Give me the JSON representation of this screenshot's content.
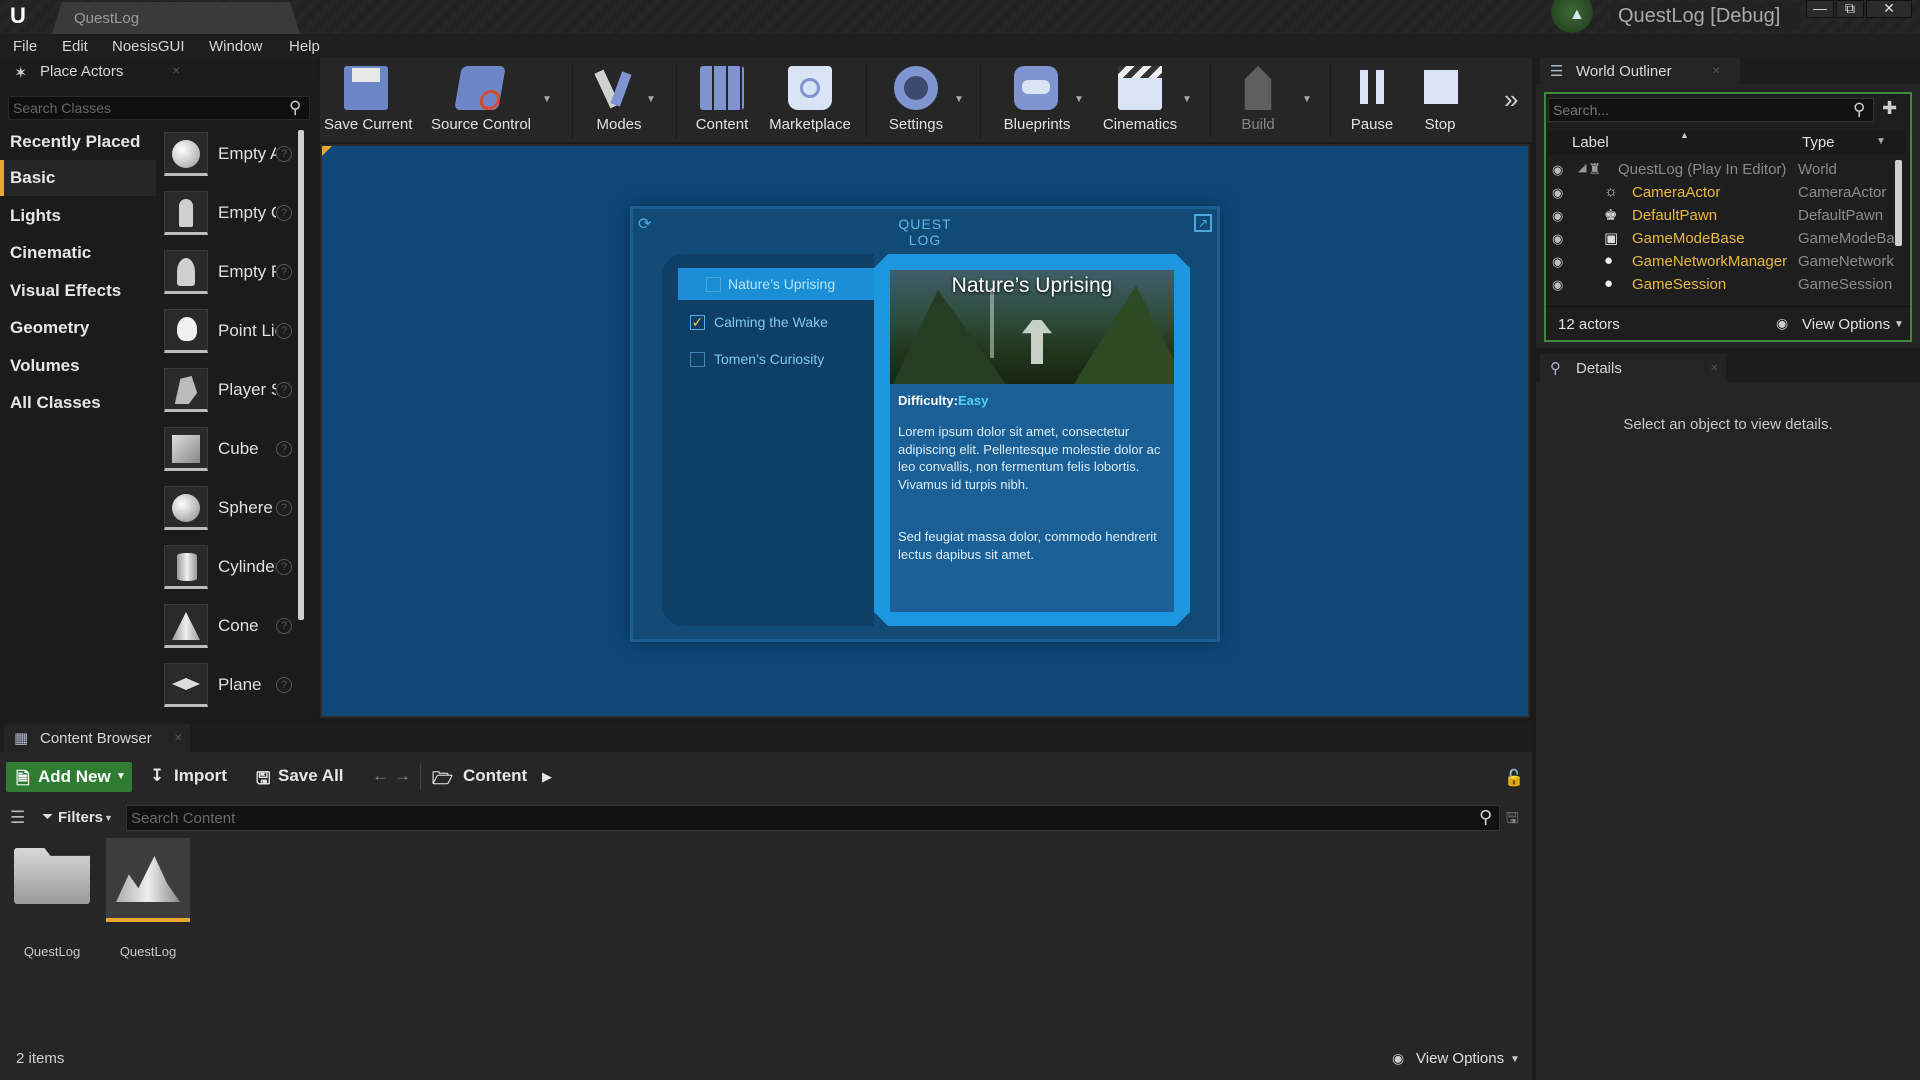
{
  "titlebar": {
    "doc_tab": "QuestLog",
    "window_title": "QuestLog [Debug]",
    "buttons": [
      "—",
      "⧉",
      "✕"
    ]
  },
  "menu": [
    "File",
    "Edit",
    "NoesisGUI",
    "Window",
    "Help"
  ],
  "place_actors": {
    "title": "Place Actors",
    "search_placeholder": "Search Classes",
    "categories": [
      "Recently Placed",
      "Basic",
      "Lights",
      "Cinematic",
      "Visual Effects",
      "Geometry",
      "Volumes",
      "All Classes"
    ],
    "active_category": "Basic",
    "actors": [
      "Empty Actor",
      "Empty Character",
      "Empty Pawn",
      "Point Light",
      "Player Start",
      "Cube",
      "Sphere",
      "Cylinder",
      "Cone",
      "Plane"
    ]
  },
  "toolbar": {
    "save_current": "Save Current",
    "source_control": "Source Control",
    "modes": "Modes",
    "content": "Content",
    "marketplace": "Marketplace",
    "settings": "Settings",
    "blueprints": "Blueprints",
    "cinematics": "Cinematics",
    "build": "Build",
    "pause": "Pause",
    "stop": "Stop"
  },
  "quest_log": {
    "title": "QUEST LOG",
    "quests": [
      {
        "name": "Nature’s Uprising",
        "checked": false,
        "selected": true
      },
      {
        "name": "Calming the Wake",
        "checked": true,
        "selected": false
      },
      {
        "name": "Tomen’s Curiosity",
        "checked": false,
        "selected": false
      }
    ],
    "detail": {
      "name": "Nature’s Uprising",
      "difficulty_label": "Difficulty:",
      "difficulty": "Easy",
      "paragraph1": "Lorem ipsum dolor sit amet, consectetur adipiscing elit. Pellentesque molestie dolor ac leo convallis, non fermentum felis lobortis. Vivamus id turpis nibh.",
      "paragraph2": "Sed feugiat massa dolor, commodo hendrerit lectus dapibus sit amet."
    }
  },
  "outliner": {
    "title": "World Outliner",
    "search_placeholder": "Search...",
    "col_label": "Label",
    "col_type": "Type",
    "rows": [
      {
        "label": "QuestLog (Play In Editor)",
        "type": "World"
      },
      {
        "label": "CameraActor",
        "type": "CameraActor"
      },
      {
        "label": "DefaultPawn",
        "type": "DefaultPawn"
      },
      {
        "label": "GameModeBase",
        "type": "GameModeBase"
      },
      {
        "label": "GameNetworkManager",
        "type": "GameNetworkManager"
      },
      {
        "label": "GameSession",
        "type": "GameSession"
      }
    ],
    "actor_count": "12 actors",
    "view_options": "View Options"
  },
  "details": {
    "title": "Details",
    "empty_text": "Select an object to view details."
  },
  "content_browser": {
    "title": "Content Browser",
    "add_new": "Add New",
    "import": "Import",
    "save_all": "Save All",
    "path": "Content",
    "filters": "Filters",
    "search_placeholder": "Search Content",
    "assets": [
      {
        "name": "QuestLog",
        "kind": "folder"
      },
      {
        "name": "QuestLog",
        "kind": "map"
      }
    ],
    "item_count": "2 items",
    "view_options": "View Options"
  },
  "colors": {
    "accent_orange": "#e9a82c",
    "quest_blue": "#1b96df",
    "viewport_blue": "#0d4878",
    "outliner_label": "#e8b840",
    "add_new_green": "#2e7d32",
    "difficulty_easy": "#4fd2f5"
  }
}
